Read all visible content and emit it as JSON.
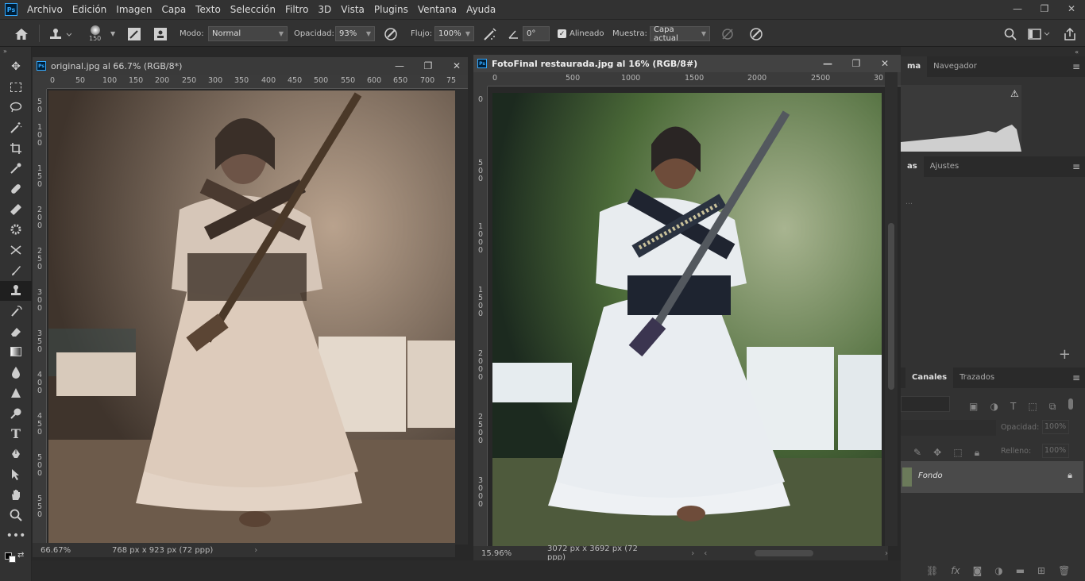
{
  "menu": {
    "logo": "Ps",
    "items": [
      "Archivo",
      "Edición",
      "Imagen",
      "Capa",
      "Texto",
      "Selección",
      "Filtro",
      "3D",
      "Vista",
      "Plugins",
      "Ventana",
      "Ayuda"
    ]
  },
  "options": {
    "brush_size": "150",
    "mode_label": "Modo:",
    "mode_value": "Normal",
    "opacity_label": "Opacidad:",
    "opacity_value": "93%",
    "flow_label": "Flujo:",
    "flow_value": "100%",
    "angle_value": "0°",
    "aligned_label": "Alineado",
    "sample_label": "Muestra:",
    "sample_value": "Capa actual"
  },
  "doc1": {
    "title": "original.jpg al 66.7% (RGB/8*)",
    "ruler_h": [
      "0",
      "50",
      "100",
      "150",
      "200",
      "250",
      "300",
      "350",
      "400",
      "450",
      "500",
      "550",
      "600",
      "650",
      "700",
      "75"
    ],
    "ruler_v": [
      "5\n0",
      "1\n0\n0",
      "1\n5\n0",
      "2\n0\n0",
      "2\n5\n0",
      "3\n0\n0",
      "3\n5\n0",
      "4\n0\n0",
      "4\n5\n0",
      "5\n0\n0",
      "5\n5\n0"
    ],
    "zoom": "66.67%",
    "dims": "768 px x 923 px (72 ppp)"
  },
  "doc2": {
    "title": "FotoFinal restaurada.jpg al 16% (RGB/8#)",
    "ruler_h": [
      "0",
      "500",
      "1000",
      "1500",
      "2000",
      "2500",
      "30"
    ],
    "ruler_v": [
      "0",
      "5\n0\n0",
      "1\n0\n0\n0",
      "1\n5\n0\n0",
      "2\n0\n0\n0",
      "2\n5\n0\n0",
      "3\n0\n0\n0"
    ],
    "zoom": "15.96%",
    "dims": "3072 px x 3692 px (72 ppp)"
  },
  "panels": {
    "top_tabs": [
      "ma",
      "Navegador"
    ],
    "mid_tabs": [
      "as",
      "Ajustes"
    ],
    "faded_hint": "...",
    "layers_tabs": [
      "Canales",
      "Trazados"
    ],
    "opacity_label": "Opacidad:",
    "opacity_value": "100%",
    "fill_label": "Relleno:",
    "fill_value": "100%",
    "layer_name": "Fondo"
  }
}
